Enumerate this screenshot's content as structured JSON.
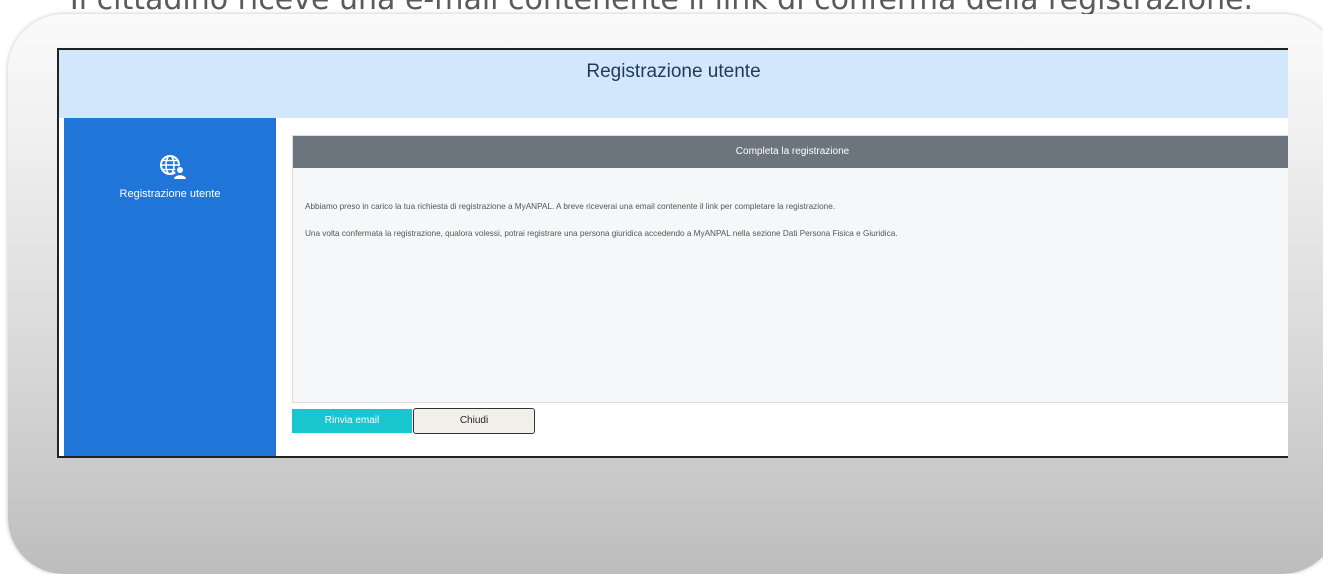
{
  "caption": "Il cittadino riceve una e-mail contenente il link di conferma della registrazione.",
  "header": {
    "title": "Registrazione utente"
  },
  "sidebar": {
    "label": "Registrazione utente",
    "icon": "globe-user-icon"
  },
  "panel": {
    "title": "Completa la registrazione",
    "paragraphs": [
      "Abbiamo preso in carico la tua richiesta di registrazione a MyANPAL. A breve riceverai una email contenente il link per completare la registrazione.",
      "Una volta confermata la registrazione, qualora volessi, potrai registrare una persona giuridica accedendo a MyANPAL nella sezione Dati Persona Fisica e Giuridica."
    ]
  },
  "buttons": {
    "resend": "Rinvia email",
    "close": "Chiudi"
  },
  "colors": {
    "header_bg": "#d3e7fc",
    "sidebar_bg": "#1f76d8",
    "panel_header_bg": "#6c757d",
    "primary_button": "#17c6cf"
  }
}
